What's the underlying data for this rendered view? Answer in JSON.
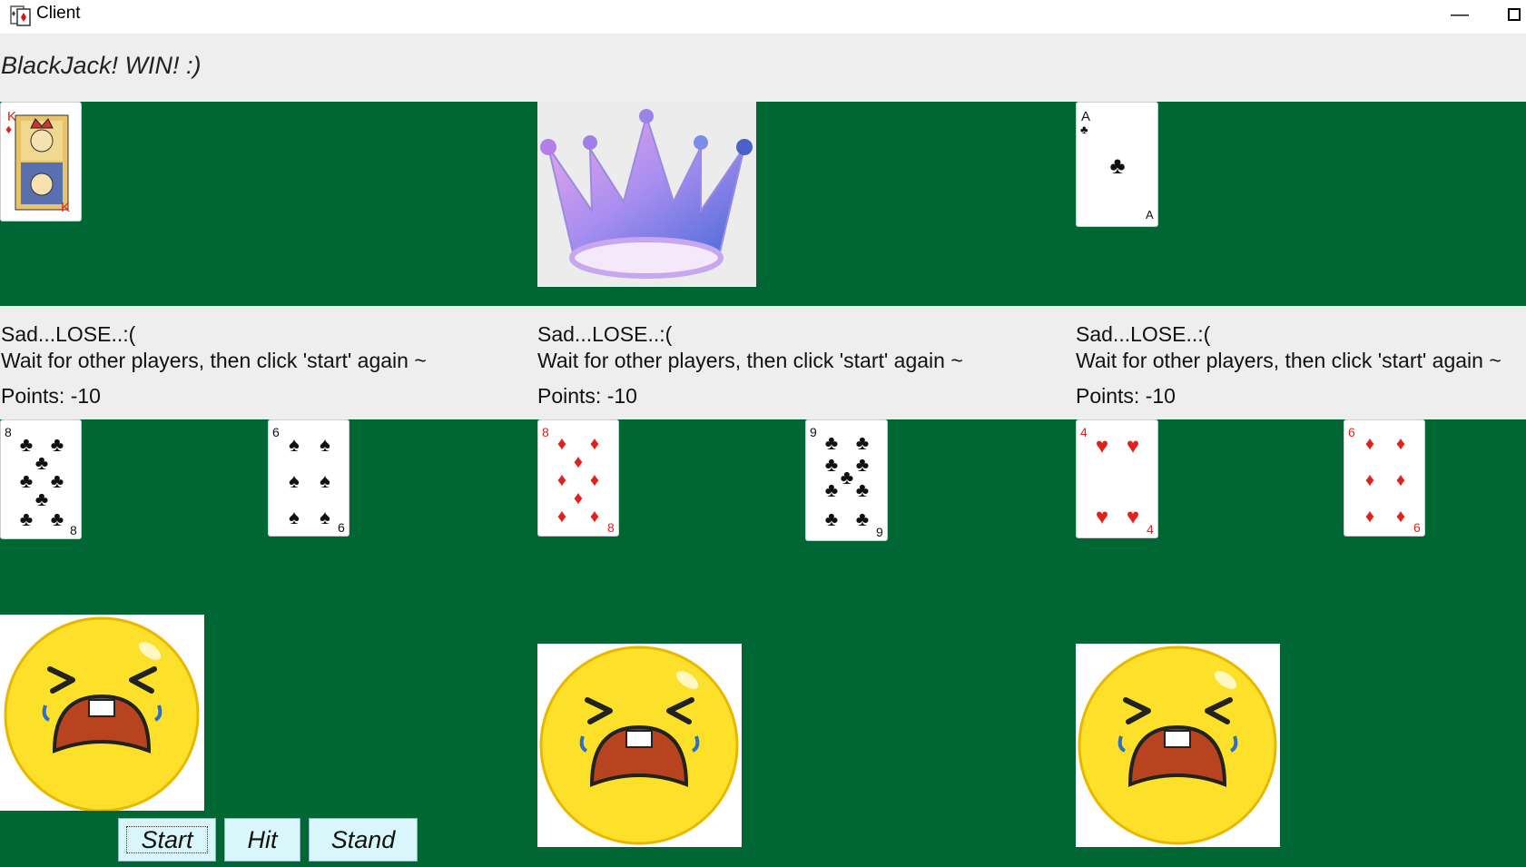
{
  "window": {
    "title": "Client",
    "minimize_glyph": "—"
  },
  "status": {
    "message": "BlackJack! WIN! :)"
  },
  "dealer": {
    "cards": [
      {
        "rank": "K",
        "suit": "diamonds",
        "suit_symbol": "♦",
        "color": "#e0221c"
      },
      {
        "rank": "A",
        "suit": "clubs",
        "suit_symbol": "♣",
        "color": "#111111"
      }
    ],
    "crown_icon": "crown-icon"
  },
  "players": [
    {
      "result": "Sad...LOSE..:(",
      "hint": "Wait for other players, then click 'start' again ~",
      "points": "Points: -10",
      "cards": [
        {
          "rank": "8",
          "suit": "clubs",
          "suit_symbol": "♣",
          "color": "#111111"
        },
        {
          "rank": "6",
          "suit": "spades",
          "suit_symbol": "♠",
          "color": "#111111"
        }
      ],
      "face_icon": "crying-face-icon"
    },
    {
      "result": "Sad...LOSE..:(",
      "hint": "Wait for other players, then click 'start' again ~",
      "points": "Points: -10",
      "cards": [
        {
          "rank": "8",
          "suit": "diamonds",
          "suit_symbol": "♦",
          "color": "#e0221c"
        },
        {
          "rank": "9",
          "suit": "clubs",
          "suit_symbol": "♣",
          "color": "#111111"
        }
      ],
      "face_icon": "crying-face-icon"
    },
    {
      "result": "Sad...LOSE..:(",
      "hint": "Wait for other players, then click 'start' again ~",
      "points": "Points: -10",
      "cards": [
        {
          "rank": "4",
          "suit": "hearts",
          "suit_symbol": "♥",
          "color": "#e0221c"
        },
        {
          "rank": "6",
          "suit": "diamonds",
          "suit_symbol": "♦",
          "color": "#e0221c"
        }
      ],
      "face_icon": "crying-face-icon"
    }
  ],
  "controls": {
    "start": "Start",
    "hit": "Hit",
    "stand": "Stand"
  },
  "colors": {
    "table_green": "#006633",
    "panel_gray": "#eeeeee",
    "button_bg": "#d9f6fb"
  }
}
